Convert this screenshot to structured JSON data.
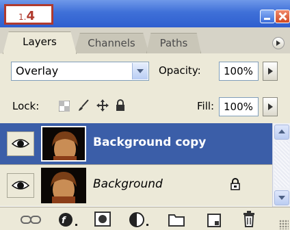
{
  "badge": {
    "step_small": "1.",
    "step_big": "4"
  },
  "tabs": [
    {
      "label": "Layers",
      "active": true
    },
    {
      "label": "Channels",
      "active": false
    },
    {
      "label": "Paths",
      "active": false
    }
  ],
  "blend": {
    "mode": "Overlay",
    "opacity_label": "Opacity:",
    "opacity_value": "100%"
  },
  "lock": {
    "label": "Lock:",
    "fill_label": "Fill:",
    "fill_value": "100%",
    "icons": [
      "lock-transparent-icon",
      "lock-image-brush-icon",
      "lock-position-move-icon",
      "lock-all-icon"
    ]
  },
  "layers": [
    {
      "name": "Background copy",
      "selected": true,
      "visible": true,
      "locked": false
    },
    {
      "name": "Background",
      "selected": false,
      "visible": true,
      "locked": true
    }
  ],
  "bottom_icons": [
    "link-layers-icon",
    "layer-style-fx-icon",
    "add-mask-icon",
    "adjustment-layer-icon",
    "new-group-folder-icon",
    "new-layer-icon",
    "delete-layer-trash-icon"
  ],
  "colors": {
    "selected_row": "#3b5ea8",
    "title_bar": "#3f70d8",
    "panel": "#ece9d8",
    "badge_border": "#b03a2e"
  }
}
